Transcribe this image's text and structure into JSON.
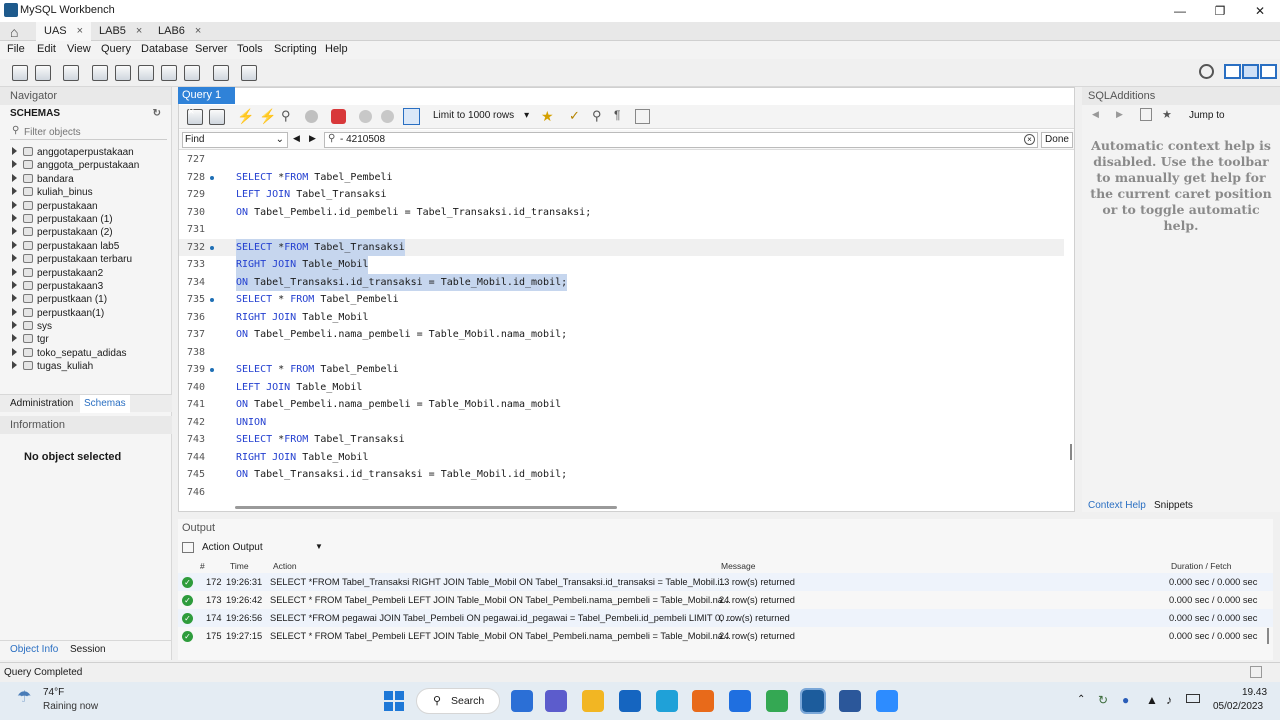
{
  "app": {
    "title": "MySQL Workbench"
  },
  "conn_tabs": [
    {
      "label": "UAS"
    },
    {
      "label": "LAB5"
    },
    {
      "label": "LAB6"
    }
  ],
  "menu": [
    "File",
    "Edit",
    "View",
    "Query",
    "Database",
    "Server",
    "Tools",
    "Scripting",
    "Help"
  ],
  "navigator": {
    "title": "Navigator",
    "schemas_label": "SCHEMAS",
    "filter_placeholder": "Filter objects",
    "schemas": [
      "anggotaperpustakaan",
      "anggota_perpustakaan",
      "bandara",
      "kuliah_binus",
      "perpustakaan",
      "perpustakaan (1)",
      "perpustakaan (2)",
      "perpustakaan lab5",
      "perpustakaan terbaru",
      "perpustakaan2",
      "perpustakaan3",
      "perpustkaan (1)",
      "perpustkaan(1)",
      "sys",
      "tgr",
      "toko_sepatu_adidas",
      "tugas_kuliah"
    ],
    "tab_admin": "Administration",
    "tab_schemas": "Schemas",
    "info_title": "Information",
    "no_object": "No object selected",
    "tab_object_info": "Object Info",
    "tab_session": "Session"
  },
  "editor": {
    "tab_label": "Query 1",
    "limit_label": "Limit to 1000 rows",
    "find_label": "Find",
    "find_value": "- 4210508",
    "done_label": "Done",
    "lines": [
      {
        "n": "727",
        "dot": false,
        "parts": []
      },
      {
        "n": "728",
        "dot": true,
        "parts": [
          {
            "t": "SELECT ",
            "k": 1
          },
          {
            "t": "*"
          },
          {
            "t": "FROM",
            "k": 1
          },
          {
            "t": " Tabel_Pembeli"
          }
        ]
      },
      {
        "n": "729",
        "dot": false,
        "parts": [
          {
            "t": "LEFT JOIN",
            "k": 1
          },
          {
            "t": " Tabel_Transaksi"
          }
        ]
      },
      {
        "n": "730",
        "dot": false,
        "parts": [
          {
            "t": "ON",
            "k": 1
          },
          {
            "t": " Tabel_Pembeli.id_pembeli = Tabel_Transaksi.id_transaksi;"
          }
        ]
      },
      {
        "n": "731",
        "dot": false,
        "parts": []
      },
      {
        "n": "732",
        "dot": true,
        "sel": true,
        "parts": [
          {
            "t": "SELECT ",
            "k": 1
          },
          {
            "t": "*"
          },
          {
            "t": "FROM",
            "k": 1
          },
          {
            "t": " Tabel_Transaksi"
          }
        ]
      },
      {
        "n": "733",
        "dot": false,
        "sel": true,
        "parts": [
          {
            "t": "RIGHT JOIN",
            "k": 1
          },
          {
            "t": " Table_Mobil"
          }
        ]
      },
      {
        "n": "734",
        "dot": false,
        "sel": true,
        "parts": [
          {
            "t": "ON",
            "k": 1
          },
          {
            "t": " Tabel_Transaksi.id_transaksi = Table_Mobil.id_mobil;"
          }
        ]
      },
      {
        "n": "735",
        "dot": true,
        "parts": [
          {
            "t": "SELECT ",
            "k": 1
          },
          {
            "t": "* "
          },
          {
            "t": "FROM",
            "k": 1
          },
          {
            "t": " Tabel_Pembeli"
          }
        ]
      },
      {
        "n": "736",
        "dot": false,
        "parts": [
          {
            "t": "RIGHT JOIN",
            "k": 1
          },
          {
            "t": " Table_Mobil"
          }
        ]
      },
      {
        "n": "737",
        "dot": false,
        "parts": [
          {
            "t": "ON",
            "k": 1
          },
          {
            "t": " Tabel_Pembeli.nama_pembeli = Table_Mobil.nama_mobil;"
          }
        ]
      },
      {
        "n": "738",
        "dot": false,
        "parts": []
      },
      {
        "n": "739",
        "dot": true,
        "parts": [
          {
            "t": "SELECT ",
            "k": 1
          },
          {
            "t": "* "
          },
          {
            "t": "FROM",
            "k": 1
          },
          {
            "t": " Tabel_Pembeli"
          }
        ]
      },
      {
        "n": "740",
        "dot": false,
        "parts": [
          {
            "t": "LEFT JOIN",
            "k": 1
          },
          {
            "t": " Table_Mobil"
          }
        ]
      },
      {
        "n": "741",
        "dot": false,
        "parts": [
          {
            "t": "ON",
            "k": 1
          },
          {
            "t": " Tabel_Pembeli.nama_pembeli = Table_Mobil.nama_mobil"
          }
        ]
      },
      {
        "n": "742",
        "dot": false,
        "parts": [
          {
            "t": "UNION",
            "k": 1
          }
        ]
      },
      {
        "n": "743",
        "dot": false,
        "parts": [
          {
            "t": "SELECT ",
            "k": 1
          },
          {
            "t": "*"
          },
          {
            "t": "FROM",
            "k": 1
          },
          {
            "t": " Tabel_Transaksi"
          }
        ]
      },
      {
        "n": "744",
        "dot": false,
        "parts": [
          {
            "t": "RIGHT JOIN",
            "k": 1
          },
          {
            "t": " Table_Mobil"
          }
        ]
      },
      {
        "n": "745",
        "dot": false,
        "parts": [
          {
            "t": "ON",
            "k": 1
          },
          {
            "t": " Tabel_Transaksi.id_transaksi = Table_Mobil.id_mobil;"
          }
        ]
      },
      {
        "n": "746",
        "dot": false,
        "parts": []
      }
    ]
  },
  "sqladditions": {
    "title": "SQLAdditions",
    "jump_label": "Jump to",
    "help_text": "Automatic context help is disabled. Use the toolbar to manually get help for the current caret position or to toggle automatic help.",
    "tab_context": "Context Help",
    "tab_snippets": "Snippets"
  },
  "output": {
    "title": "Output",
    "selector": "Action Output",
    "headers": {
      "num": "#",
      "time": "Time",
      "action": "Action",
      "message": "Message",
      "duration": "Duration / Fetch"
    },
    "rows": [
      {
        "num": "172",
        "time": "19:26:31",
        "action": "SELECT *FROM Tabel_Transaksi RIGHT JOIN Table_Mobil ON Tabel_Transaksi.id_transaksi = Table_Mobil.i...",
        "message": "13 row(s) returned",
        "duration": "0.000 sec / 0.000 sec"
      },
      {
        "num": "173",
        "time": "19:26:42",
        "action": "SELECT * FROM Tabel_Pembeli LEFT JOIN Table_Mobil ON Tabel_Pembeli.nama_pembeli = Table_Mobil.na...",
        "message": "24 row(s) returned",
        "duration": "0.000 sec / 0.000 sec"
      },
      {
        "num": "174",
        "time": "19:26:56",
        "action": "SELECT *FROM pegawai JOIN Tabel_Pembeli ON pegawai.id_pegawai = Tabel_Pembeli.id_pembeli LIMIT 0, ...",
        "message": "0 row(s) returned",
        "duration": "0.000 sec / 0.000 sec"
      },
      {
        "num": "175",
        "time": "19:27:15",
        "action": "SELECT * FROM Tabel_Pembeli LEFT JOIN Table_Mobil ON Tabel_Pembeli.nama_pembeli = Table_Mobil.na...",
        "message": "24 row(s) returned",
        "duration": "0.000 sec / 0.000 sec"
      }
    ]
  },
  "status": {
    "text": "Query Completed"
  },
  "taskbar": {
    "weather_temp": "74°F",
    "weather_desc": "Raining now",
    "search_label": "Search",
    "time": "19.43",
    "date": "05/02/2023",
    "app_colors": [
      "#2b6fd6",
      "#5c5ccc",
      "#f2b623",
      "#1565c0",
      "#1fa1d8",
      "#e86a1a",
      "#1f6fe0",
      "#34a853",
      "#1c5c9c",
      "#2b579a",
      "#2d8cff"
    ]
  }
}
